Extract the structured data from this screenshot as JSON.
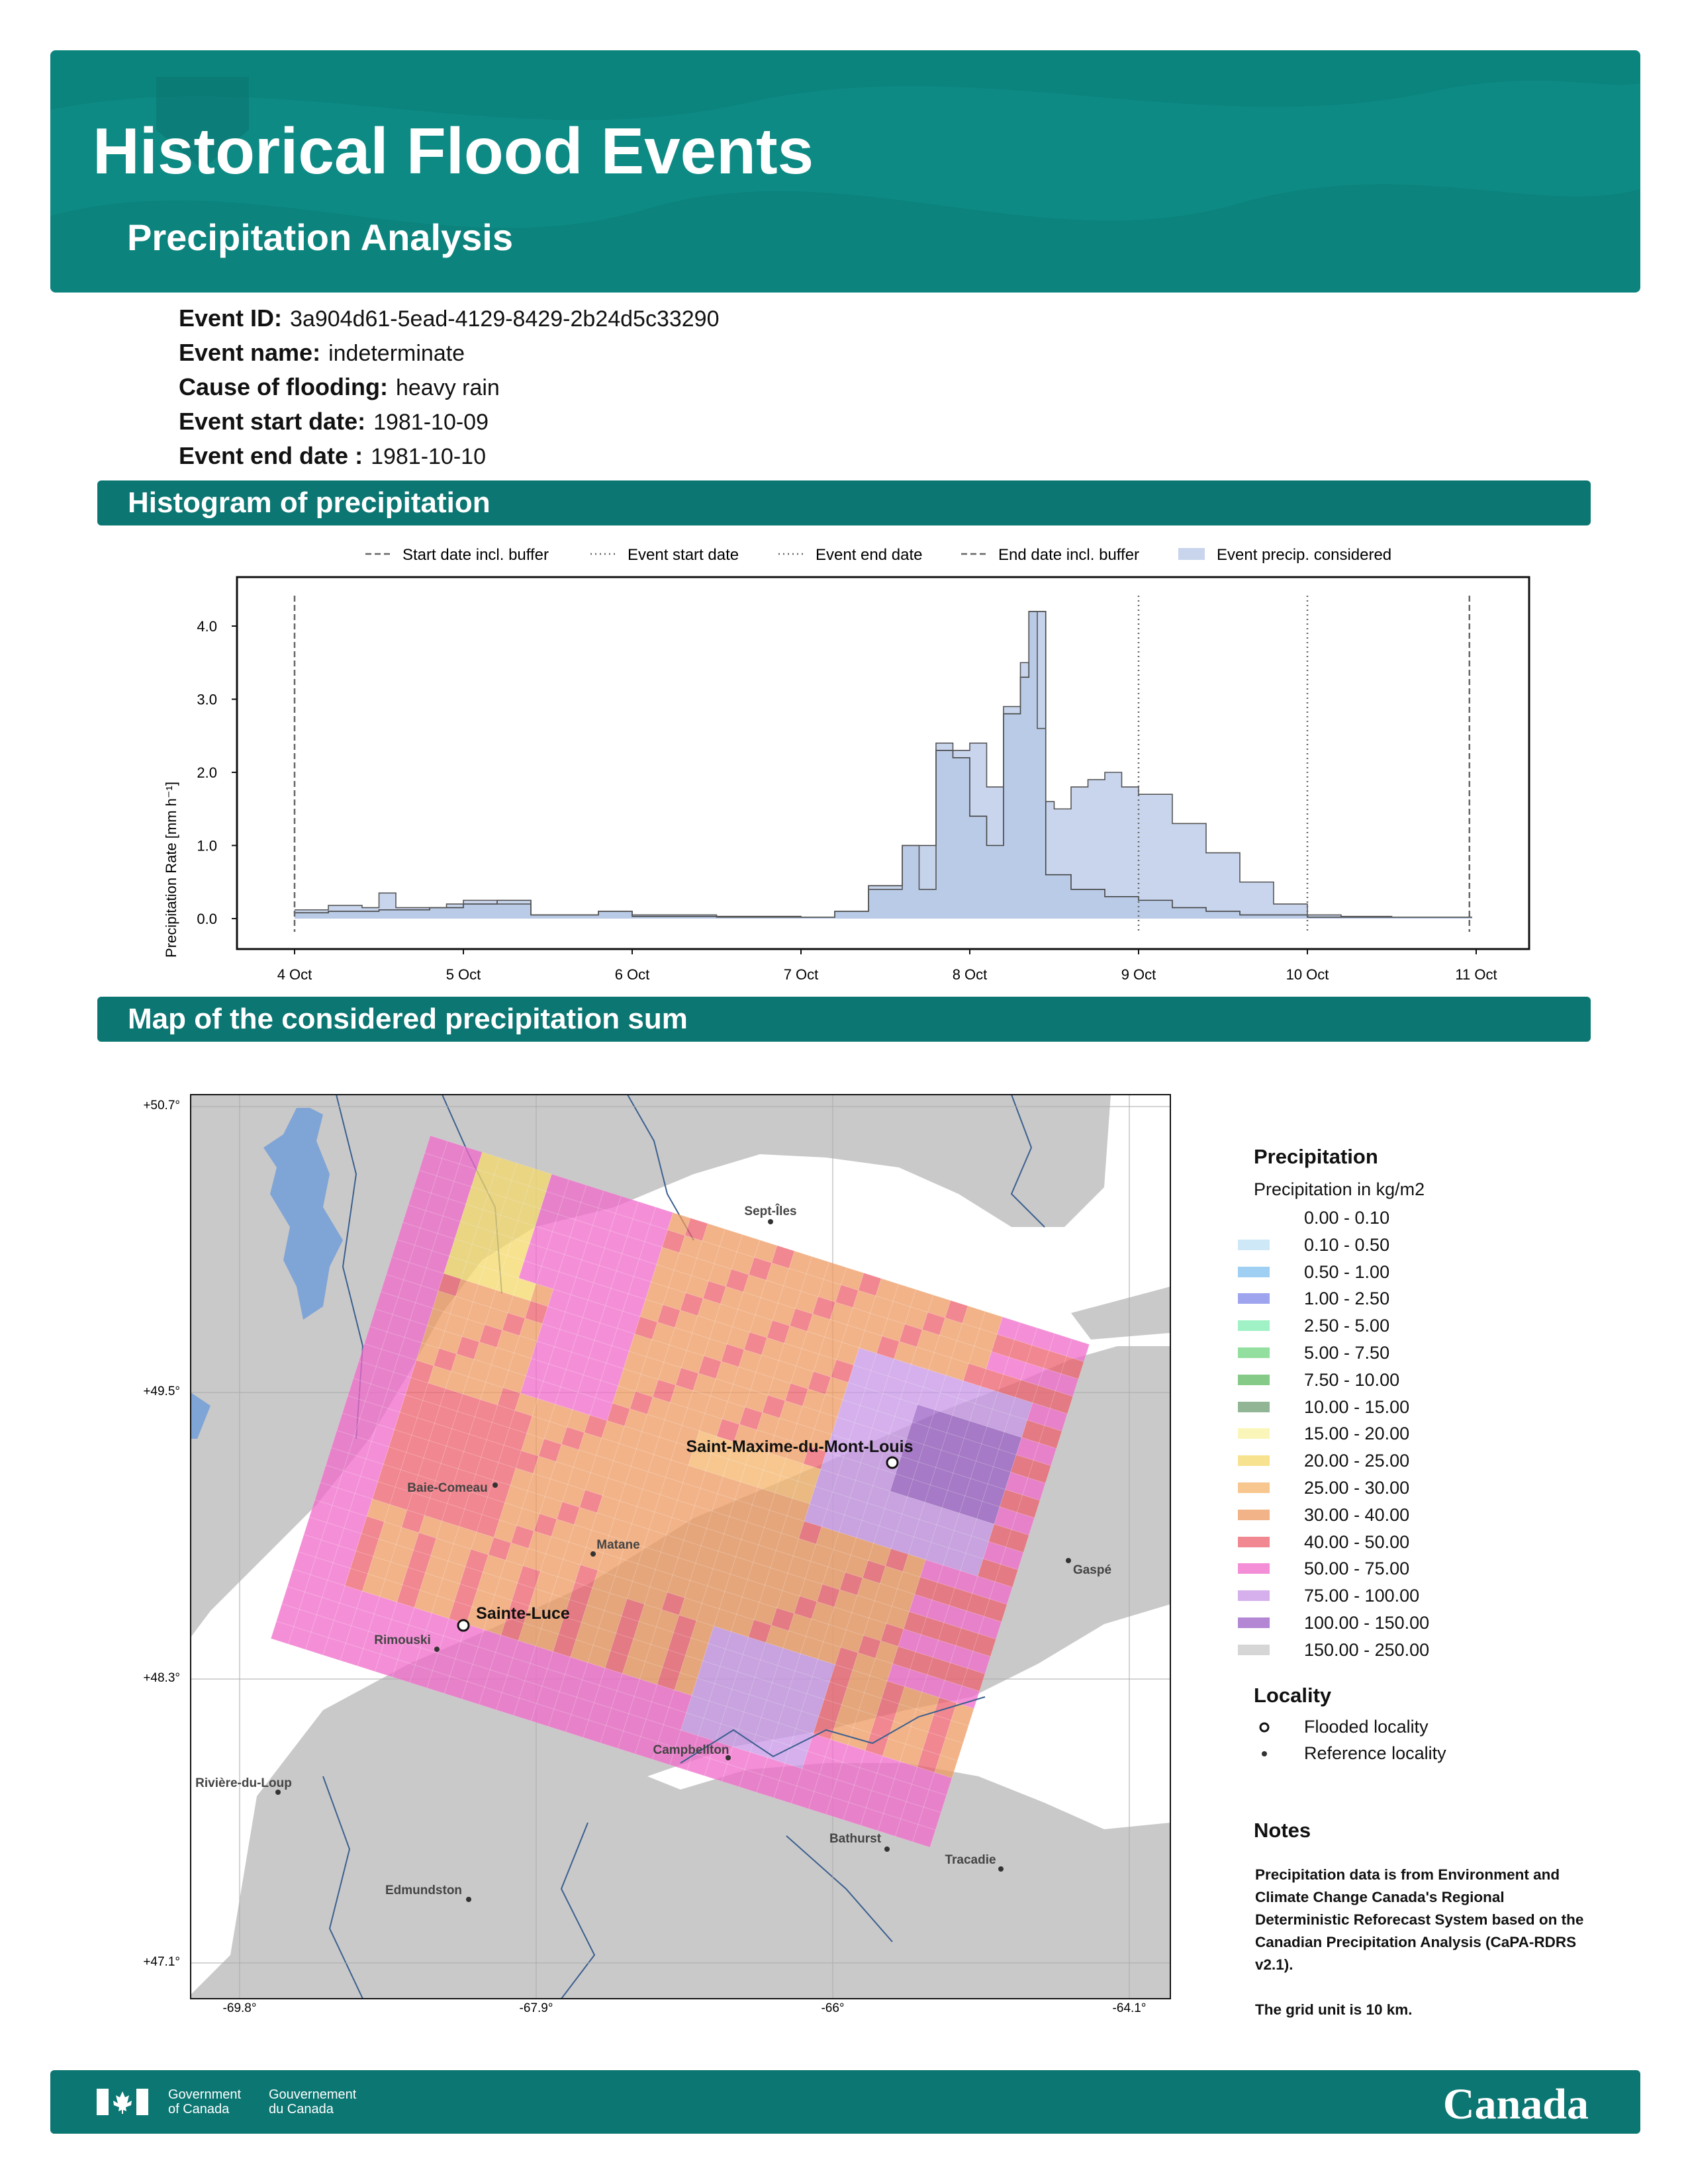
{
  "header": {
    "title": "Historical Flood Events",
    "subtitle": "Precipitation Analysis"
  },
  "event": {
    "id_label": "Event ID:",
    "id_value": "3a904d61-5ead-4129-8429-2b24d5c33290",
    "name_label": "Event name:",
    "name_value": "indeterminate",
    "cause_label": "Cause of flooding:",
    "cause_value": "heavy rain",
    "start_label": "Event start date:",
    "start_value": "1981-10-09",
    "end_label": "Event end date :",
    "end_value": "1981-10-10"
  },
  "sections": {
    "histogram": "Histogram of precipitation",
    "map": "Map of the considered precipitation sum"
  },
  "histogram": {
    "legend": {
      "start_buffer": "Start date incl. buffer",
      "event_start": "Event start date",
      "event_end": "Event end date",
      "end_buffer": "End date incl. buffer",
      "considered": "Event precip. considered"
    },
    "ylabel": "Precipitation Rate [mm h⁻¹]"
  },
  "chart_data": {
    "type": "area",
    "ylabel": "Precipitation Rate [mm h⁻¹]",
    "xlabel": "",
    "ylim": [
      0,
      4.4
    ],
    "y_ticks": [
      "0.0",
      "1.0",
      "2.0",
      "3.0",
      "4.0"
    ],
    "x_ticks": [
      "4 Oct",
      "5 Oct",
      "6 Oct",
      "7 Oct",
      "8 Oct",
      "9 Oct",
      "10 Oct",
      "11 Oct"
    ],
    "x_unit": "days since 4 Oct 00:00",
    "vlines": [
      {
        "name": "Start date incl. buffer",
        "x": 0.0,
        "style": "dashed"
      },
      {
        "name": "Event start date",
        "x": 5.0,
        "style": "dotted"
      },
      {
        "name": "Event end date",
        "x": 6.0,
        "style": "dotted"
      },
      {
        "name": "End date incl. buffer",
        "x": 6.96,
        "style": "dashed"
      }
    ],
    "series": [
      {
        "name": "Event precip. considered",
        "x": [
          0.0,
          0.2,
          0.4,
          0.5,
          0.6,
          0.9,
          1.0,
          1.2,
          1.4,
          1.8,
          2.0,
          2.5,
          3.0,
          3.2,
          3.4,
          3.5,
          3.6,
          3.7,
          3.8,
          3.9,
          4.0,
          4.1,
          4.2,
          4.3,
          4.35,
          4.4,
          4.45,
          4.5,
          4.6,
          4.7,
          4.8,
          4.9,
          5.0,
          5.2,
          5.4,
          5.6,
          5.8,
          6.0,
          6.2,
          6.5,
          6.96
        ],
        "values": [
          0.12,
          0.18,
          0.15,
          0.35,
          0.15,
          0.2,
          0.25,
          0.2,
          0.05,
          0.1,
          0.05,
          0.02,
          0.02,
          0.1,
          0.4,
          0.4,
          1.0,
          0.4,
          2.4,
          2.3,
          2.4,
          1.8,
          2.9,
          3.5,
          4.2,
          2.6,
          1.6,
          1.5,
          1.8,
          1.9,
          2.0,
          1.8,
          1.7,
          1.3,
          0.9,
          0.5,
          0.2,
          0.05,
          0.03,
          0.02,
          0.02
        ]
      },
      {
        "name": "Total precipitation",
        "x": [
          0.0,
          0.2,
          0.5,
          0.8,
          1.0,
          1.2,
          1.4,
          1.8,
          2.0,
          3.0,
          3.2,
          3.4,
          3.6,
          3.8,
          3.9,
          4.0,
          4.1,
          4.2,
          4.3,
          4.35,
          4.45,
          4.5,
          4.6,
          4.8,
          5.0,
          5.2,
          5.4,
          5.6,
          6.0,
          6.96
        ],
        "values": [
          0.08,
          0.1,
          0.12,
          0.15,
          0.2,
          0.25,
          0.05,
          0.1,
          0.03,
          0.02,
          0.1,
          0.45,
          1.0,
          2.3,
          2.2,
          1.4,
          1.0,
          2.8,
          3.3,
          4.2,
          0.6,
          0.6,
          0.4,
          0.3,
          0.25,
          0.15,
          0.1,
          0.05,
          0.02,
          0.02
        ]
      }
    ]
  },
  "map": {
    "lat_ticks": [
      "+50.7°",
      "+49.5°",
      "+48.3°",
      "+47.1°"
    ],
    "lon_ticks": [
      "-69.8°",
      "-67.9°",
      "-66°",
      "-64.1°"
    ],
    "flooded_localities": [
      "Saint-Maxime-du-Mont-Louis",
      "Sainte-Luce"
    ],
    "reference_localities": [
      "Sept-Îles",
      "Baie-Comeau",
      "Matane",
      "Gaspé",
      "Rimouski",
      "Campbellton",
      "Rivière-du-Loup",
      "Bathurst",
      "Tracadie",
      "Edmundston"
    ],
    "legend": {
      "title": "Precipitation",
      "subtitle": "Precipitation in kg/m2",
      "classes": [
        {
          "label": "0.00 - 0.10",
          "color": "#ffffff"
        },
        {
          "label": "0.10 - 0.50",
          "color": "#bfe0f6"
        },
        {
          "label": "0.50 - 1.00",
          "color": "#7fbfee"
        },
        {
          "label": "1.00 - 2.50",
          "color": "#7f86e8"
        },
        {
          "label": "2.50 - 5.00",
          "color": "#80ecb1"
        },
        {
          "label": "5.00 - 7.50",
          "color": "#6fd47f"
        },
        {
          "label": "7.50 - 10.00",
          "color": "#5cb85f"
        },
        {
          "label": "10.00 - 15.00",
          "color": "#6e9d72"
        },
        {
          "label": "15.00 - 20.00",
          "color": "#f8f3a3"
        },
        {
          "label": "20.00 - 25.00",
          "color": "#f4d86b"
        },
        {
          "label": "25.00 - 30.00",
          "color": "#f4b46a"
        },
        {
          "label": "30.00 - 40.00",
          "color": "#ee9a60"
        },
        {
          "label": "40.00 - 50.00",
          "color": "#ec5f6b"
        },
        {
          "label": "50.00 - 75.00",
          "color": "#f06ac9"
        },
        {
          "label": "75.00 - 100.00",
          "color": "#c796e6"
        },
        {
          "label": "100.00 - 150.00",
          "color": "#9a5fc4"
        },
        {
          "label": "150.00 - 250.00",
          "color": "#c8c8c8"
        }
      ],
      "locality_title": "Locality",
      "flooded": "Flooded locality",
      "reference": "Reference locality"
    }
  },
  "notes": {
    "title": "Notes",
    "text": "Precipitation data is from Environment and Climate Change Canada's Regional Deterministic Reforecast System based on the Canadian Precipitation Analysis (CaPA-RDRS v2.1).",
    "grid": "The grid unit is 10 km."
  },
  "footer": {
    "gov_en_1": "Government",
    "gov_en_2": "of Canada",
    "gov_fr_1": "Gouvernement",
    "gov_fr_2": "du Canada",
    "wordmark": "Canada"
  }
}
